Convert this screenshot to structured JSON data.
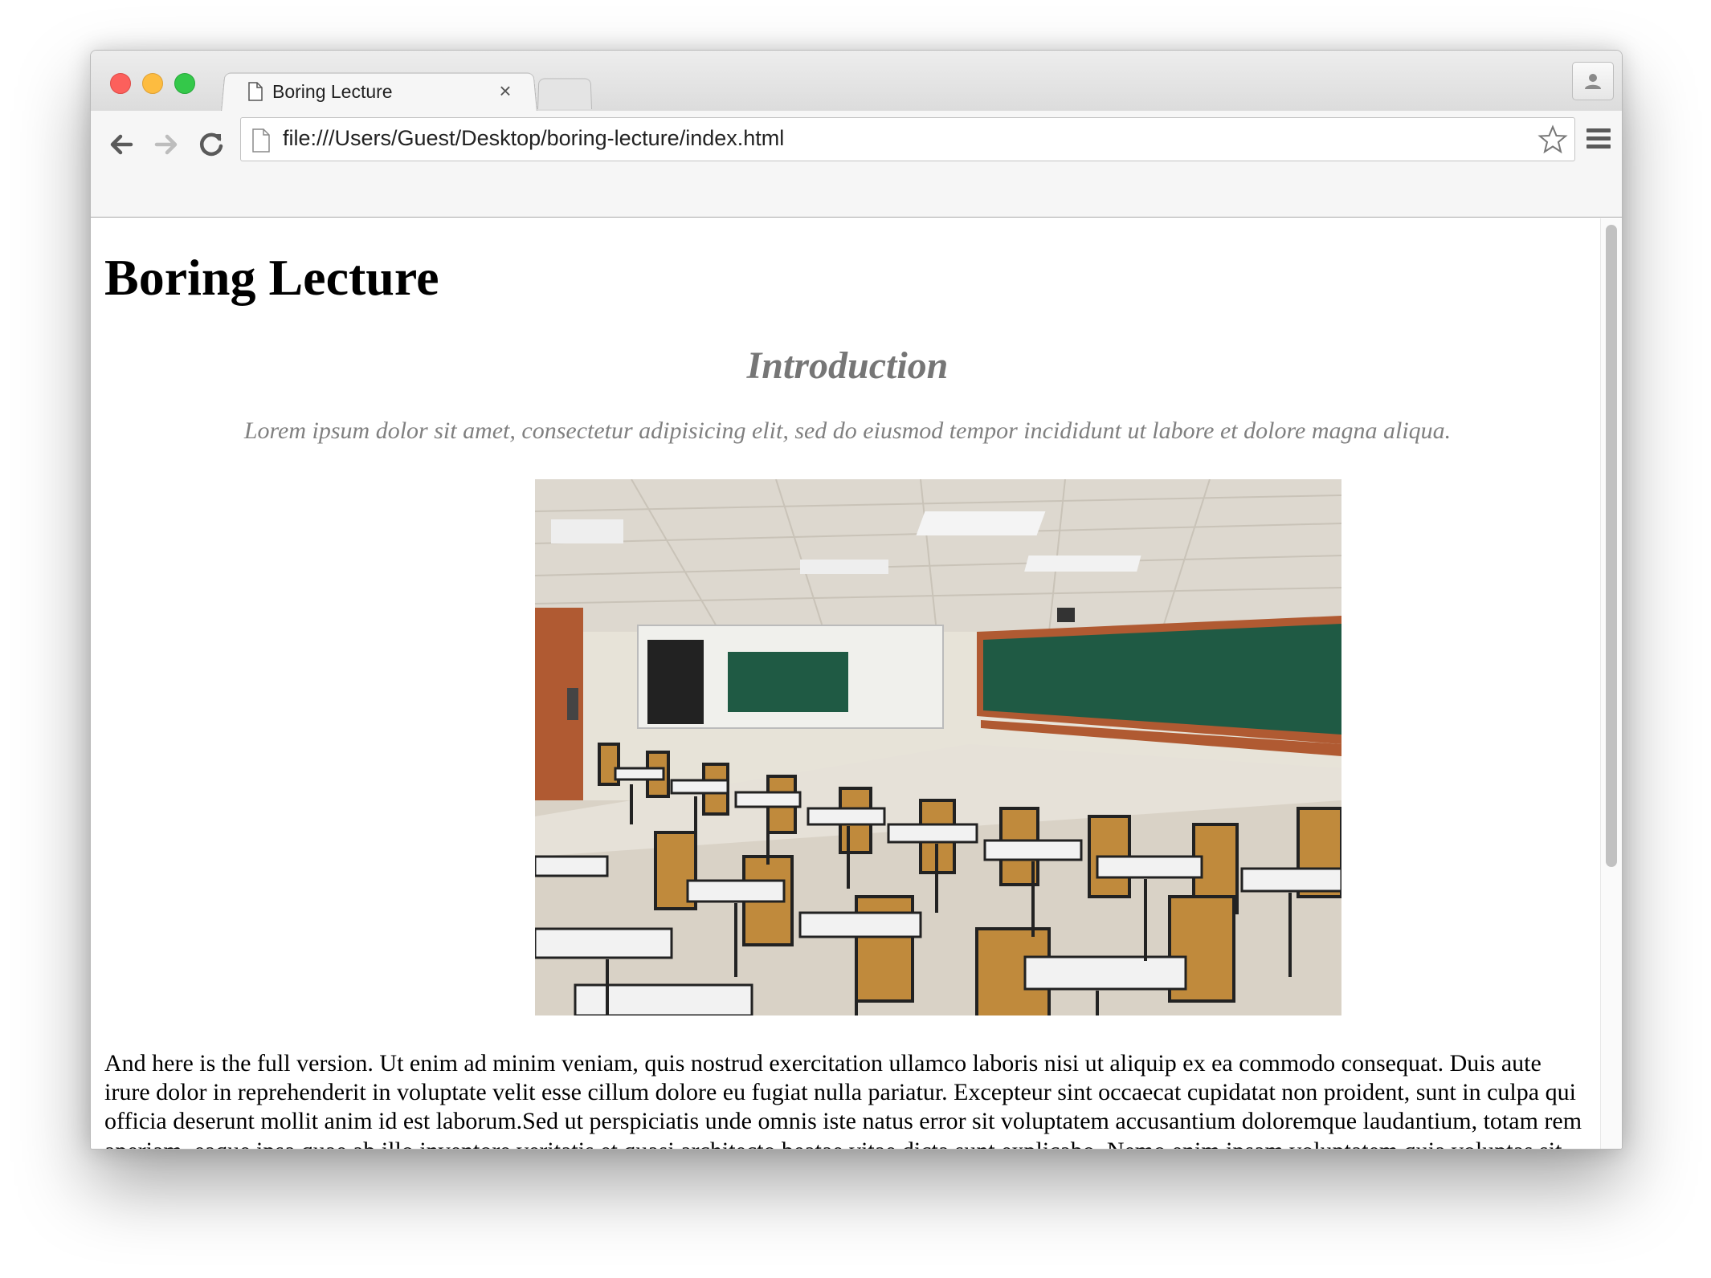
{
  "browser": {
    "tab_title": "Boring Lecture",
    "tab_close_glyph": "×",
    "url": "file:///Users/Guest/Desktop/boring-lecture/index.html",
    "icons": [
      "back-arrow-icon",
      "forward-arrow-icon",
      "reload-icon",
      "page-icon",
      "star-icon",
      "menu-icon",
      "profile-icon"
    ]
  },
  "page": {
    "title": "Boring Lecture",
    "section_heading": "Introduction",
    "summary": "Lorem ipsum dolor sit amet, consectetur adipisicing elit, sed do eiusmod tempor incididunt ut labore et dolore magna aliqua.",
    "image_description": "classroom with rows of desks and green chalkboard",
    "body": "And here is the full version. Ut enim ad minim veniam, quis nostrud exercitation ullamco laboris nisi ut aliquip ex ea commodo consequat. Duis aute irure dolor in reprehenderit in voluptate velit esse cillum dolore eu fugiat nulla pariatur. Excepteur sint occaecat cupidatat non proident, sunt in culpa qui officia deserunt mollit anim id est laborum.Sed ut perspiciatis unde omnis iste natus error sit voluptatem accusantium doloremque laudantium, totam rem aperiam, eaque ipsa quae ab illo inventore veritatis et quasi architecto beatae vitae dicta sunt explicabo. Nemo enim ipsam voluptatem quia voluptas sit aspernatur aut odit aut fugit, sed quia consequuntur magni dolores eos qui ratione voluptatem sequi nesciunt."
  },
  "colors": {
    "close": "#fc605c",
    "minimize": "#fdbc40",
    "maximize": "#34c84a",
    "heading_gray": "#767676",
    "chalkboard": "#1f5a44"
  }
}
